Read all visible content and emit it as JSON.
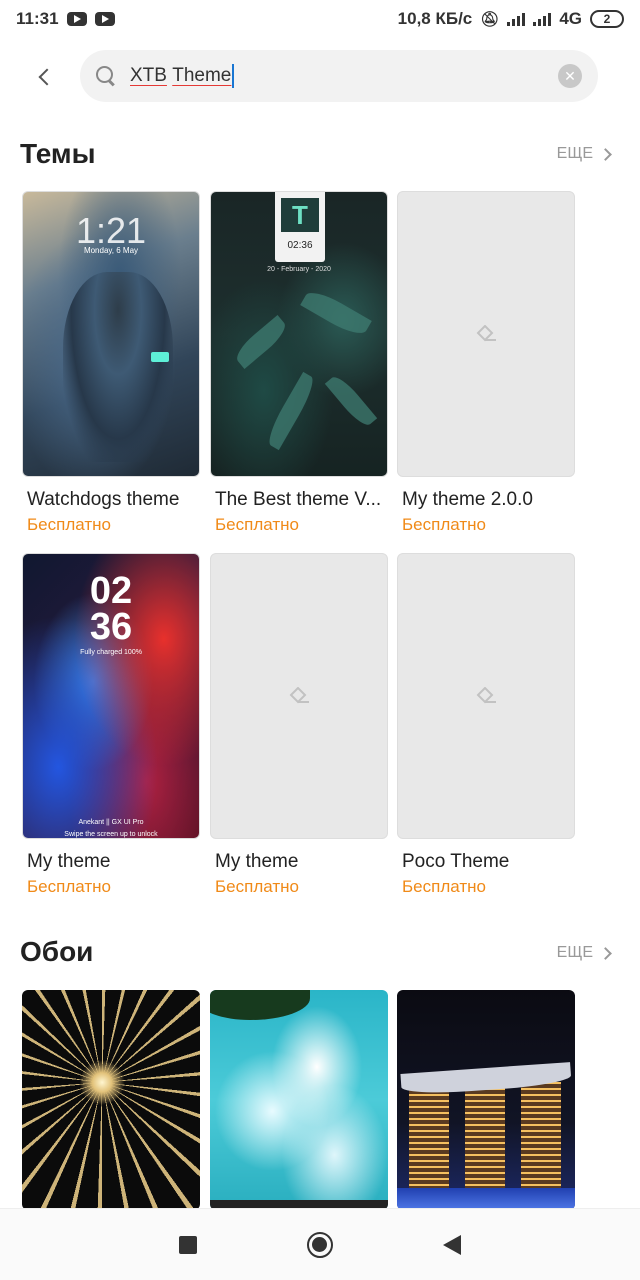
{
  "status_bar": {
    "time": "11:31",
    "speed": "10,8 КБ/с",
    "network": "4G",
    "battery": "2"
  },
  "search": {
    "query_word1": "XTB",
    "query_word2": "Theme",
    "clear_icon": "clear-icon",
    "search_icon": "search-icon"
  },
  "themes_section": {
    "title": "Темы",
    "more_label": "ЕЩЕ",
    "items": [
      {
        "name": "Watchdogs theme",
        "price": "Бесплатно",
        "thumb_time": "1:21",
        "thumb_date": "Monday, 6 May"
      },
      {
        "name": "The Best theme V...",
        "price": "Бесплатно",
        "thumb_logo": "T",
        "thumb_time": "02:36",
        "thumb_date": "20 - February - 2020"
      },
      {
        "name": "My theme 2.0.0",
        "price": "Бесплатно"
      },
      {
        "name": "My theme",
        "price": "Бесплатно",
        "thumb_hours": "02",
        "thumb_minutes": "36",
        "thumb_battery": "Fully charged 100%",
        "thumb_footer1": "Anekant || GX UI Pro",
        "thumb_footer2": "Swipe the screen up to unlock"
      },
      {
        "name": "My theme",
        "price": "Бесплатно"
      },
      {
        "name": "Poco Theme",
        "price": "Бесплатно"
      }
    ]
  },
  "wallpapers_section": {
    "title": "Обои",
    "more_label": "ЕЩЕ"
  },
  "colors": {
    "price": "#f08a18",
    "accent_caret": "#1976d2"
  }
}
